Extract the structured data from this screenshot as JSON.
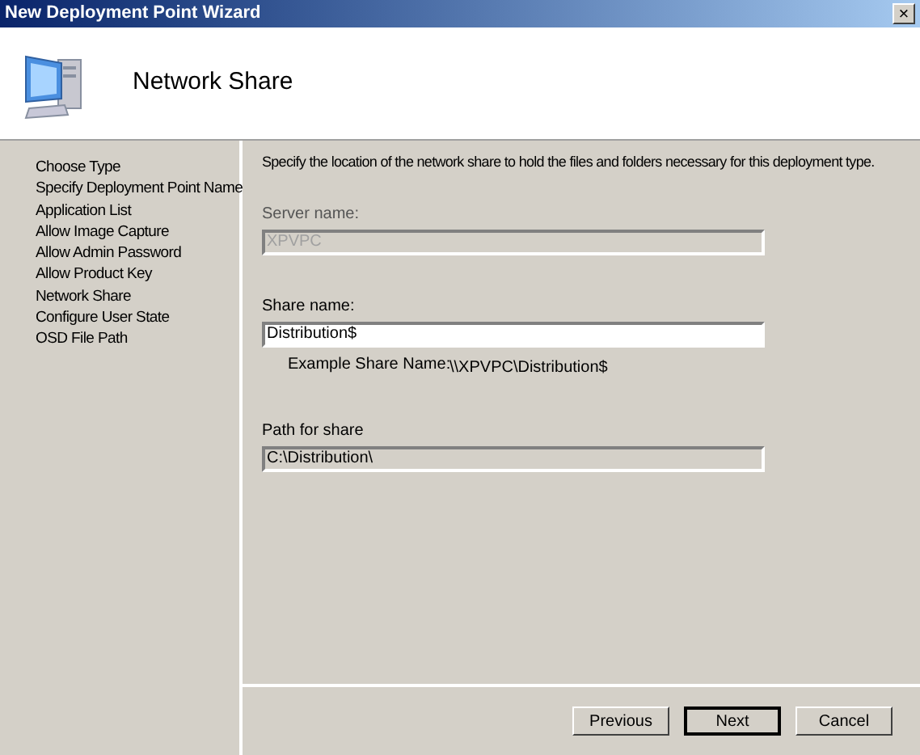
{
  "window": {
    "title": "New Deployment Point Wizard",
    "close": "×"
  },
  "header": {
    "title": "Network Share"
  },
  "steps": [
    {
      "label": "Choose Type"
    },
    {
      "label": "Specify Deployment Point Name"
    },
    {
      "label": "Application List"
    },
    {
      "label": "Allow Image Capture"
    },
    {
      "label": "Allow Admin Password"
    },
    {
      "label": "Allow Product Key"
    },
    {
      "label": "Network Share"
    },
    {
      "label": "Configure User State"
    },
    {
      "label": "OSD File Path"
    }
  ],
  "instructions": "Specify the location of the network share to hold the files and folders necessary for this deployment type.",
  "fields": [
    {
      "label": "Server name:",
      "value": "XPVPC",
      "kind": "disabled"
    },
    {
      "label": "Share name:",
      "value": "Distribution$",
      "kind": "editable",
      "example_label": "Example Share Name:",
      "example_value": "\\\\XPVPC\\Distribution$"
    },
    {
      "label": "Path for share",
      "value": "C:\\Distribution\\",
      "kind": "readonly"
    }
  ],
  "buttons": [
    {
      "label": "Previous",
      "default": false
    },
    {
      "label": "Next",
      "default": true
    },
    {
      "label": "Cancel",
      "default": false
    }
  ]
}
